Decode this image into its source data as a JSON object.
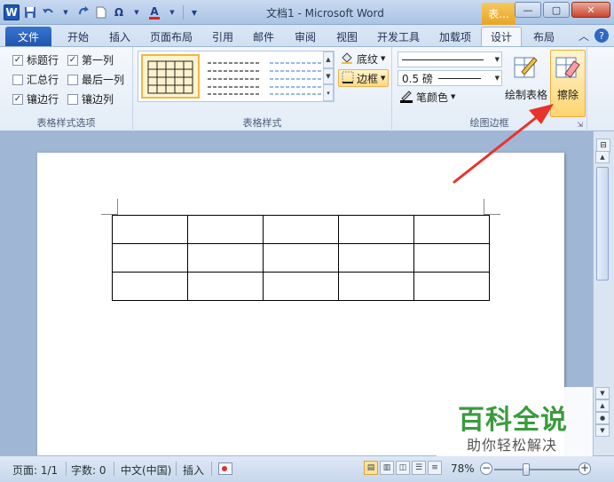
{
  "window": {
    "title": "文档1 - Microsoft Word",
    "context_tab": "表...",
    "app_icon": "W",
    "buttons": {
      "minimize": "—",
      "maximize": "▢",
      "close": "✕"
    }
  },
  "quick_access": {
    "icons": [
      "save-icon",
      "undo-icon",
      "redo-icon",
      "new-document-icon",
      "symbol-omega-icon",
      "font-color-icon",
      "customize-icon"
    ],
    "symbol_glyph": "Ω",
    "font_color_glyph": "A"
  },
  "tabs": {
    "file": "文件",
    "items": [
      "开始",
      "插入",
      "页面布局",
      "引用",
      "邮件",
      "审阅",
      "视图",
      "开发工具",
      "加载项",
      "设计",
      "布局"
    ],
    "active": "设计"
  },
  "ribbon": {
    "style_options": {
      "label": "表格样式选项",
      "items": [
        {
          "label": "标题行",
          "checked": true
        },
        {
          "label": "第一列",
          "checked": true
        },
        {
          "label": "汇总行",
          "checked": false
        },
        {
          "label": "最后一列",
          "checked": false
        },
        {
          "label": "镶边行",
          "checked": true
        },
        {
          "label": "镶边列",
          "checked": false
        }
      ]
    },
    "table_styles": {
      "label": "表格样式",
      "shading": "底纹",
      "borders": "边框"
    },
    "draw_borders": {
      "label": "绘图边框",
      "line_weight": "0.5 磅",
      "pen_color": "笔颜色",
      "draw_table": "绘制表格",
      "eraser": "擦除"
    }
  },
  "document": {
    "table": {
      "rows": 3,
      "cols": 5
    }
  },
  "statusbar": {
    "page": "页面: 1/1",
    "words": "字数: 0",
    "language": "中文(中国)",
    "mode": "插入",
    "zoom": "78%",
    "zoom_value": 78
  },
  "watermark": {
    "title": "百科全说",
    "subtitle": "助你轻松解决"
  },
  "annotation": {
    "color": "#e8322c"
  }
}
